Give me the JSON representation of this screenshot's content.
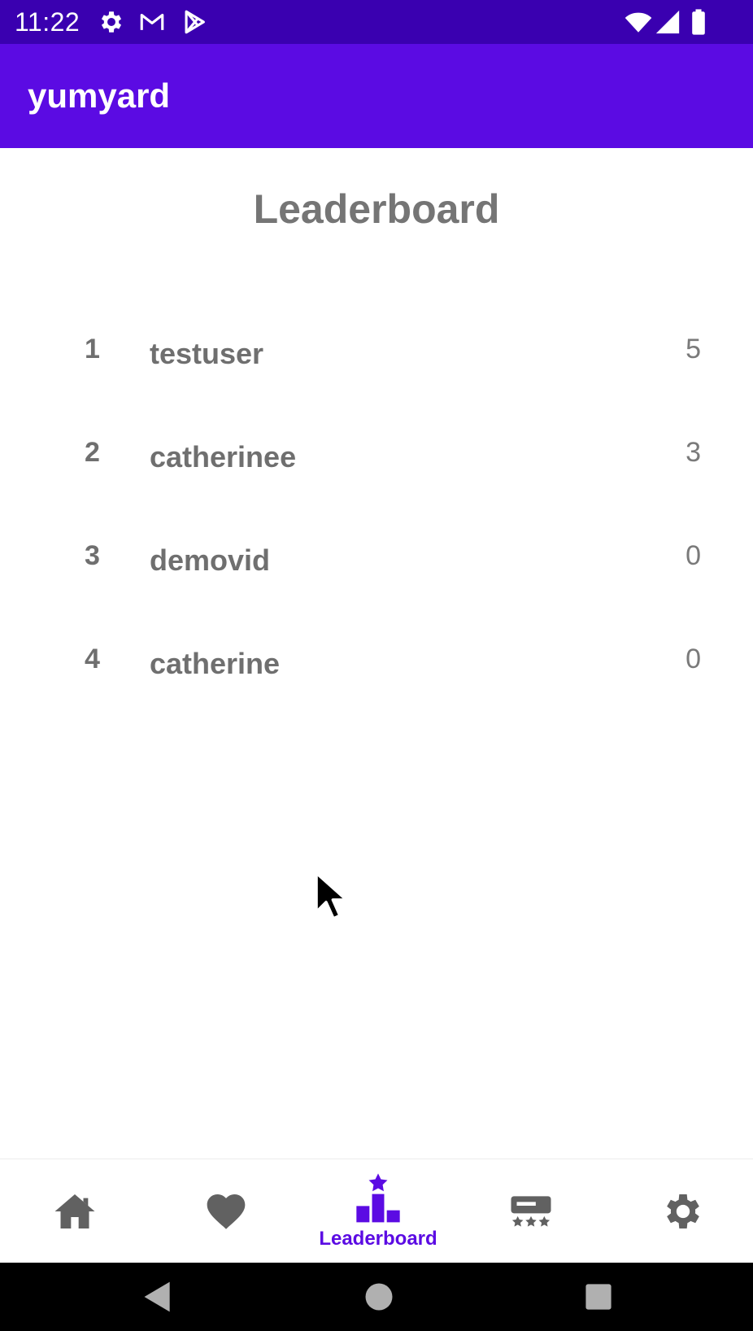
{
  "status_bar": {
    "time": "11:22",
    "icons": [
      "gear-icon",
      "gmail-icon",
      "play-store-icon",
      "wifi-icon",
      "signal-icon",
      "battery-icon"
    ]
  },
  "app_bar": {
    "title": "yumyard",
    "background": "#5b0be3"
  },
  "leaderboard": {
    "title": "Leaderboard",
    "rows": [
      {
        "rank": "1",
        "name": "testuser",
        "score": "5"
      },
      {
        "rank": "2",
        "name": "catherinee",
        "score": "3"
      },
      {
        "rank": "3",
        "name": "demovid",
        "score": "0"
      },
      {
        "rank": "4",
        "name": "catherine",
        "score": "0"
      }
    ]
  },
  "bottom_nav": {
    "items": [
      {
        "icon": "home-icon",
        "label": ""
      },
      {
        "icon": "heart-icon",
        "label": ""
      },
      {
        "icon": "leaderboard-icon",
        "label": "Leaderboard",
        "active": true
      },
      {
        "icon": "rating-icon",
        "label": ""
      },
      {
        "icon": "settings-icon",
        "label": ""
      }
    ],
    "active_color": "#5b0be3",
    "inactive_color": "#616161"
  },
  "system_nav": {
    "icons": [
      "back-icon",
      "home-circle-icon",
      "recents-icon"
    ]
  }
}
